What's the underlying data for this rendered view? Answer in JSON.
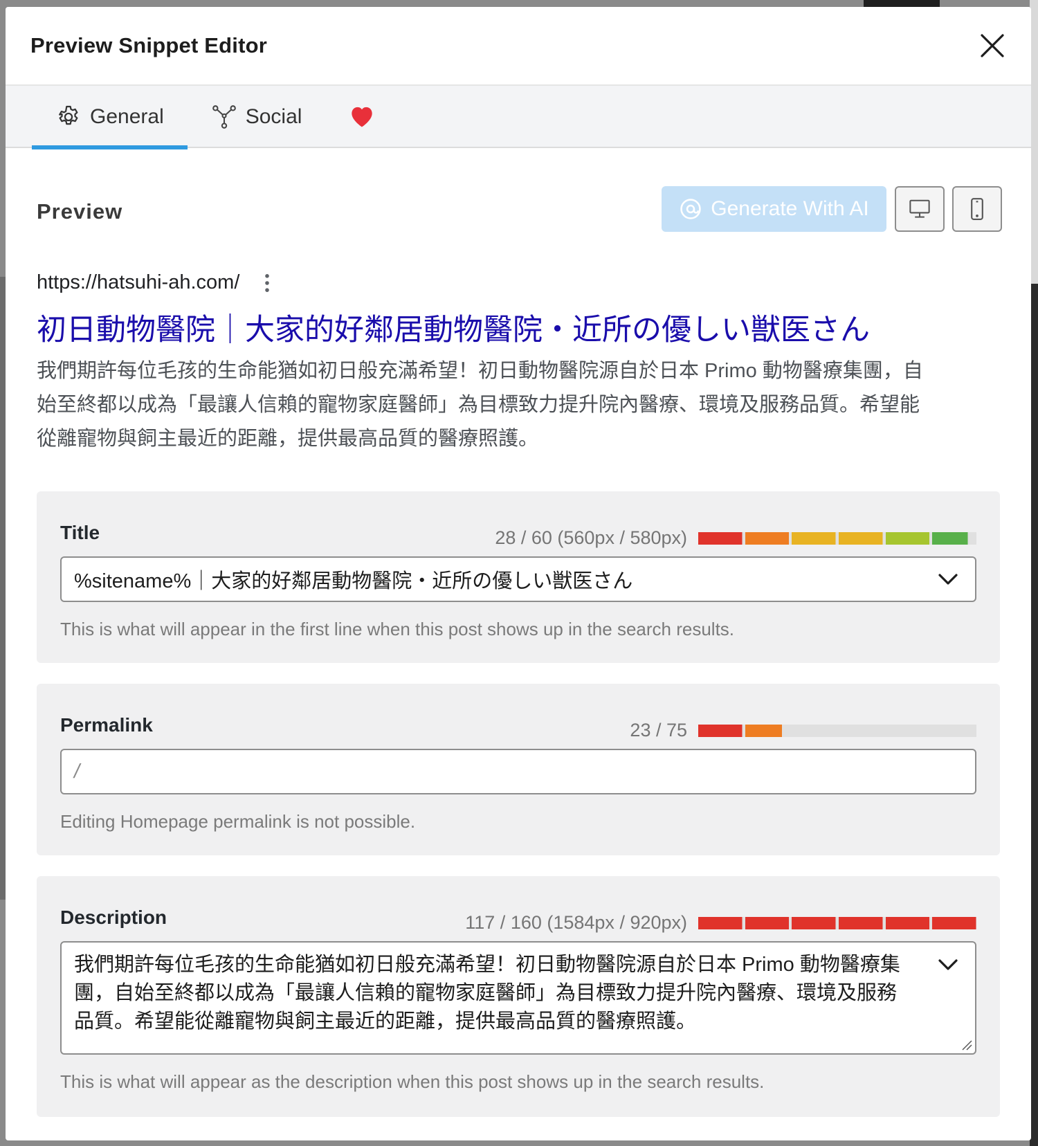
{
  "modal": {
    "title": "Preview Snippet Editor",
    "close_icon": "close-icon"
  },
  "tabs": [
    {
      "label": "General",
      "icon": "gear-icon",
      "active": true
    },
    {
      "label": "Social",
      "icon": "share-nodes-icon",
      "active": false
    },
    {
      "label": "",
      "icon": "heart-icon",
      "active": false
    }
  ],
  "preview": {
    "label": "Preview",
    "ai_button": "Generate With AI",
    "device_icons": [
      "desktop-icon",
      "mobile-icon"
    ]
  },
  "serp": {
    "url": "https://hatsuhi-ah.com/",
    "title": "初日動物醫院｜大家的好鄰居動物醫院・近所の優しい獣医さん",
    "description": "我們期許每位毛孩的生命能猶如初日般充滿希望！初日動物醫院源自於日本 Primo 動物醫療集團，自始至終都以成為「最讓人信賴的寵物家庭醫師」為目標致力提升院內醫療、環境及服務品質。希望能從離寵物與飼主最近的距離，提供最高品質的醫療照護。"
  },
  "fields": {
    "title": {
      "label": "Title",
      "count": "28 / 60 (560px / 580px)",
      "fill": 0.97,
      "value": "%sitename%｜大家的好鄰居動物醫院・近所の優しい獣医さん",
      "help": "This is what will appear in the first line when this post shows up in the search results."
    },
    "permalink": {
      "label": "Permalink",
      "count": "23 / 75",
      "fill": 0.3,
      "value": "/",
      "help": "Editing Homepage permalink is not possible."
    },
    "description": {
      "label": "Description",
      "count": "117 / 160 (1584px / 920px)",
      "fill": 1.0,
      "value": "我們期許每位毛孩的生命能猶如初日般充滿希望！初日動物醫院源自於日本 Primo 動物醫療集團，自始至終都以成為「最讓人信賴的寵物家庭醫師」為目標致力提升院內醫療、環境及服務品質。希望能從離寵物與飼主最近的距離，提供最高品質的醫療照護。",
      "help": "This is what will appear as the description when this post shows up in the search results."
    }
  },
  "colors": {
    "accent": "#2f9ae0",
    "serp_title": "#1a0dab",
    "meter_red": "#e0332b",
    "meter_orange": "#ee7d22",
    "meter_yellow": "#e8b323",
    "meter_lime": "#a6c52f",
    "meter_green": "#58b04a"
  }
}
